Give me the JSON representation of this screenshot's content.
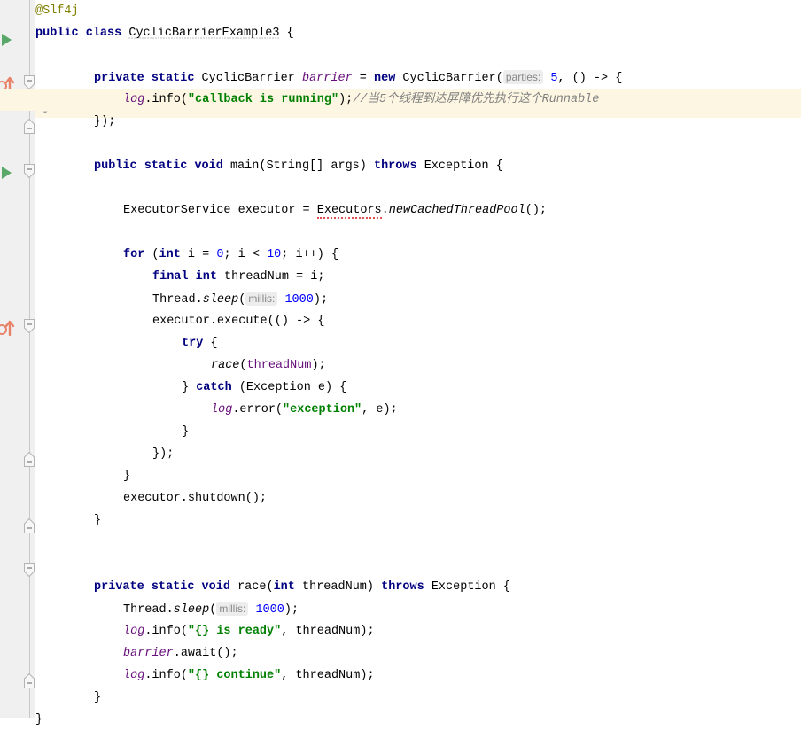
{
  "editor": {
    "language": "java",
    "theme": "intellij-light",
    "background": "#ffffff",
    "gutter_background": "#f0f0f0",
    "highlight_line_background": "#fdf6e3",
    "colors": {
      "keyword": "#000080",
      "string": "#008000",
      "number": "#0000ff",
      "comment": "#808080",
      "annotation": "#808000",
      "static_field": "#660e7a",
      "parameter_hint_text": "#868686",
      "parameter_hint_background": "#ededed",
      "run_marker_green": "#59a869",
      "implementation_marker_red": "#e8836a"
    },
    "highlighted_line_number": 2
  },
  "gutter": {
    "markers": [
      {
        "name": "run-class-marker",
        "type": "run-triangle",
        "line": 1
      },
      {
        "name": "implemented-method-marker",
        "type": "arrow-up",
        "line": 3
      },
      {
        "name": "run-method-marker",
        "type": "run-triangle",
        "line": 7
      },
      {
        "name": "implemented-method-marker-2",
        "type": "arrow-up",
        "line": 14
      }
    ],
    "fold_markers": [
      {
        "line": 3,
        "direction": "down"
      },
      {
        "line": 5,
        "direction": "up"
      },
      {
        "line": 7,
        "direction": "down"
      },
      {
        "line": 14,
        "direction": "down"
      },
      {
        "line": 20,
        "direction": "up"
      },
      {
        "line": 22,
        "direction": "up"
      },
      {
        "line": 24,
        "direction": "down"
      },
      {
        "line": 30,
        "direction": "up"
      }
    ],
    "intention_bulb": {
      "name": "intention-bulb-icon",
      "line": 4,
      "tooltip": "Show intention actions"
    }
  },
  "code": {
    "lines": [
      {
        "n": 1,
        "indent": 0,
        "tokens": [
          {
            "t": "@Slf4j",
            "c": "anno"
          }
        ]
      },
      {
        "n": 2,
        "indent": 0,
        "tokens": [
          {
            "t": "public",
            "c": "kw"
          },
          {
            "t": " ",
            "c": "plain"
          },
          {
            "t": "class",
            "c": "kw"
          },
          {
            "t": " ",
            "c": "plain"
          },
          {
            "t": "CyclicBarrierExample3",
            "c": "warn"
          },
          {
            "t": " {",
            "c": "plain"
          }
        ]
      },
      {
        "n": 3,
        "indent": 0,
        "tokens": []
      },
      {
        "n": 4,
        "indent": 2,
        "tokens": [
          {
            "t": "private",
            "c": "kw"
          },
          {
            "t": " ",
            "c": "plain"
          },
          {
            "t": "static",
            "c": "kw"
          },
          {
            "t": " ",
            "c": "plain"
          },
          {
            "t": "CyclicBarrier ",
            "c": "plain"
          },
          {
            "t": "barrier",
            "c": "fld"
          },
          {
            "t": " = ",
            "c": "plain"
          },
          {
            "t": "new",
            "c": "kw"
          },
          {
            "t": " ",
            "c": "plain"
          },
          {
            "t": "CyclicBarrier(",
            "c": "plain"
          },
          {
            "t": "parties:",
            "c": "hint"
          },
          {
            "t": " ",
            "c": "plain"
          },
          {
            "t": "5",
            "c": "num"
          },
          {
            "t": ", () -> {",
            "c": "plain"
          }
        ]
      },
      {
        "n": 5,
        "indent": 3,
        "highlight": true,
        "tokens": [
          {
            "t": "log",
            "c": "fld"
          },
          {
            "t": ".info(",
            "c": "plain"
          },
          {
            "t": "\"callback is running\"",
            "c": "str"
          },
          {
            "t": ");",
            "c": "plain"
          },
          {
            "t": "//当5个线程到达屏障优先执行这个Runnable",
            "c": "cmt"
          }
        ]
      },
      {
        "n": 6,
        "indent": 2,
        "tokens": [
          {
            "t": "});",
            "c": "plain"
          }
        ]
      },
      {
        "n": 7,
        "indent": 0,
        "tokens": []
      },
      {
        "n": 8,
        "indent": 2,
        "tokens": [
          {
            "t": "public",
            "c": "kw"
          },
          {
            "t": " ",
            "c": "plain"
          },
          {
            "t": "static",
            "c": "kw"
          },
          {
            "t": " ",
            "c": "plain"
          },
          {
            "t": "void",
            "c": "kw"
          },
          {
            "t": " ",
            "c": "plain"
          },
          {
            "t": "main(String[] args) ",
            "c": "plain"
          },
          {
            "t": "throws",
            "c": "kw"
          },
          {
            "t": " Exception {",
            "c": "plain"
          }
        ]
      },
      {
        "n": 9,
        "indent": 0,
        "tokens": []
      },
      {
        "n": 10,
        "indent": 3,
        "tokens": [
          {
            "t": "ExecutorService executor = ",
            "c": "plain"
          },
          {
            "t": "Executors",
            "c": "err"
          },
          {
            "t": ".",
            "c": "plain"
          },
          {
            "t": "newCachedThreadPool",
            "c": "stm"
          },
          {
            "t": "();",
            "c": "plain"
          }
        ]
      },
      {
        "n": 11,
        "indent": 0,
        "tokens": []
      },
      {
        "n": 12,
        "indent": 3,
        "tokens": [
          {
            "t": "for",
            "c": "kw"
          },
          {
            "t": " (",
            "c": "plain"
          },
          {
            "t": "int",
            "c": "kw"
          },
          {
            "t": " i = ",
            "c": "plain"
          },
          {
            "t": "0",
            "c": "num"
          },
          {
            "t": "; i < ",
            "c": "plain"
          },
          {
            "t": "10",
            "c": "num"
          },
          {
            "t": "; i++) {",
            "c": "plain"
          }
        ]
      },
      {
        "n": 13,
        "indent": 4,
        "tokens": [
          {
            "t": "final",
            "c": "kw"
          },
          {
            "t": " ",
            "c": "plain"
          },
          {
            "t": "int",
            "c": "kw"
          },
          {
            "t": " threadNum = i;",
            "c": "plain"
          }
        ]
      },
      {
        "n": 14,
        "indent": 4,
        "tokens": [
          {
            "t": "Thread.",
            "c": "plain"
          },
          {
            "t": "sleep",
            "c": "stm"
          },
          {
            "t": "(",
            "c": "plain"
          },
          {
            "t": "millis:",
            "c": "hint"
          },
          {
            "t": " ",
            "c": "plain"
          },
          {
            "t": "1000",
            "c": "num"
          },
          {
            "t": ");",
            "c": "plain"
          }
        ]
      },
      {
        "n": 15,
        "indent": 4,
        "tokens": [
          {
            "t": "executor.execute(() -> {",
            "c": "plain"
          }
        ]
      },
      {
        "n": 16,
        "indent": 5,
        "tokens": [
          {
            "t": "try",
            "c": "kw"
          },
          {
            "t": " {",
            "c": "plain"
          }
        ]
      },
      {
        "n": 17,
        "indent": 6,
        "tokens": [
          {
            "t": "race",
            "c": "stm"
          },
          {
            "t": "(",
            "c": "plain"
          },
          {
            "t": "threadNum",
            "c": "param"
          },
          {
            "t": ");",
            "c": "plain"
          }
        ]
      },
      {
        "n": 18,
        "indent": 5,
        "tokens": [
          {
            "t": "} ",
            "c": "plain"
          },
          {
            "t": "catch",
            "c": "kw"
          },
          {
            "t": " (Exception e) {",
            "c": "plain"
          }
        ]
      },
      {
        "n": 19,
        "indent": 6,
        "tokens": [
          {
            "t": "log",
            "c": "fld"
          },
          {
            "t": ".error(",
            "c": "plain"
          },
          {
            "t": "\"exception\"",
            "c": "str"
          },
          {
            "t": ", e);",
            "c": "plain"
          }
        ]
      },
      {
        "n": 20,
        "indent": 5,
        "tokens": [
          {
            "t": "}",
            "c": "plain"
          }
        ]
      },
      {
        "n": 21,
        "indent": 4,
        "tokens": [
          {
            "t": "});",
            "c": "plain"
          }
        ]
      },
      {
        "n": 22,
        "indent": 3,
        "tokens": [
          {
            "t": "}",
            "c": "plain"
          }
        ]
      },
      {
        "n": 23,
        "indent": 3,
        "tokens": [
          {
            "t": "executor.shutdown();",
            "c": "plain"
          }
        ]
      },
      {
        "n": 24,
        "indent": 2,
        "tokens": [
          {
            "t": "}",
            "c": "plain"
          }
        ]
      },
      {
        "n": 25,
        "indent": 0,
        "tokens": []
      },
      {
        "n": 26,
        "indent": 0,
        "tokens": []
      },
      {
        "n": 27,
        "indent": 2,
        "tokens": [
          {
            "t": "private",
            "c": "kw"
          },
          {
            "t": " ",
            "c": "plain"
          },
          {
            "t": "static",
            "c": "kw"
          },
          {
            "t": " ",
            "c": "plain"
          },
          {
            "t": "void",
            "c": "kw"
          },
          {
            "t": " ",
            "c": "plain"
          },
          {
            "t": "race(",
            "c": "plain"
          },
          {
            "t": "int",
            "c": "kw"
          },
          {
            "t": " threadNum) ",
            "c": "plain"
          },
          {
            "t": "throws",
            "c": "kw"
          },
          {
            "t": " Exception {",
            "c": "plain"
          }
        ]
      },
      {
        "n": 28,
        "indent": 3,
        "tokens": [
          {
            "t": "Thread.",
            "c": "plain"
          },
          {
            "t": "sleep",
            "c": "stm"
          },
          {
            "t": "(",
            "c": "plain"
          },
          {
            "t": "millis:",
            "c": "hint"
          },
          {
            "t": " ",
            "c": "plain"
          },
          {
            "t": "1000",
            "c": "num"
          },
          {
            "t": ");",
            "c": "plain"
          }
        ]
      },
      {
        "n": 29,
        "indent": 3,
        "tokens": [
          {
            "t": "log",
            "c": "fld"
          },
          {
            "t": ".info(",
            "c": "plain"
          },
          {
            "t": "\"{} is ready\"",
            "c": "str"
          },
          {
            "t": ", threadNum);",
            "c": "plain"
          }
        ]
      },
      {
        "n": 30,
        "indent": 3,
        "tokens": [
          {
            "t": "barrier",
            "c": "fld"
          },
          {
            "t": ".await();",
            "c": "plain"
          }
        ]
      },
      {
        "n": 31,
        "indent": 3,
        "tokens": [
          {
            "t": "log",
            "c": "fld"
          },
          {
            "t": ".info(",
            "c": "plain"
          },
          {
            "t": "\"{} continue\"",
            "c": "str"
          },
          {
            "t": ", threadNum);",
            "c": "plain"
          }
        ]
      },
      {
        "n": 32,
        "indent": 2,
        "tokens": [
          {
            "t": "}",
            "c": "plain"
          }
        ]
      },
      {
        "n": 33,
        "indent": 0,
        "tokens": [
          {
            "t": "}",
            "c": "plain"
          }
        ]
      }
    ]
  }
}
